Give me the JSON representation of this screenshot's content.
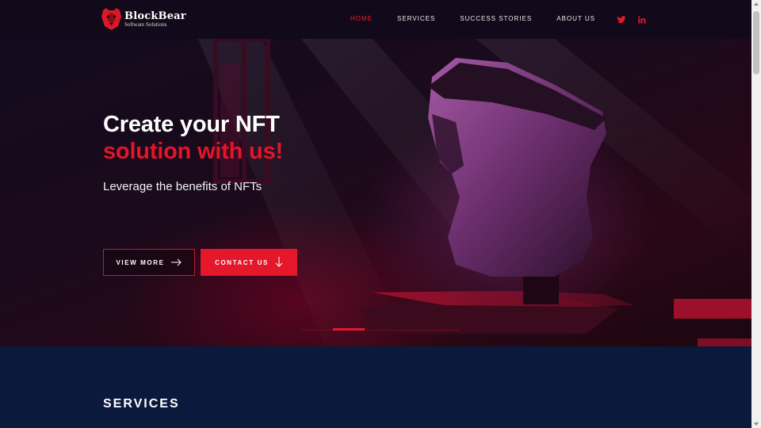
{
  "brand": {
    "name": "BlockBear",
    "tagline": "Software Solutions",
    "logo_icon": "bear-shield-icon",
    "accent_color": "#e5172b"
  },
  "nav": {
    "items": [
      {
        "label": "HOME",
        "active": true
      },
      {
        "label": "SERVICES",
        "active": false
      },
      {
        "label": "SUCCESS STORIES",
        "active": false
      },
      {
        "label": "ABOUT US",
        "active": false
      }
    ],
    "social": [
      {
        "icon": "twitter-icon"
      },
      {
        "icon": "linkedin-icon"
      }
    ]
  },
  "hero": {
    "title_line1": "Create your NFT",
    "title_line2": "solution with us!",
    "subtitle": "Leverage the benefits of NFTs",
    "view_more_label": "VIEW MORE",
    "view_more_icon": "arrow-right-icon",
    "contact_label": "CONTACT US",
    "contact_icon": "arrow-down-icon",
    "slider": {
      "current": 2,
      "total": 5
    }
  },
  "services": {
    "heading": "SERVICES"
  }
}
